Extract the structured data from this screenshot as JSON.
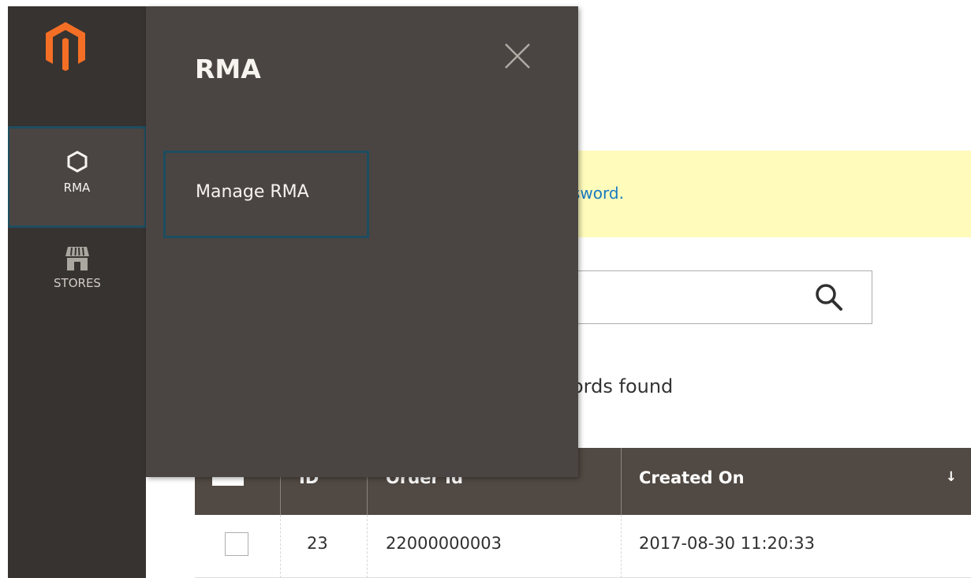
{
  "sidebar": {
    "logo": "magento-logo",
    "items": [
      {
        "label": "RMA",
        "icon": "hexagon-icon",
        "active": true
      },
      {
        "label": "STORES",
        "icon": "store-icon",
        "active": false
      }
    ]
  },
  "flyout": {
    "title": "RMA",
    "close_icon": "close-icon",
    "items": [
      {
        "label": "Manage RMA"
      }
    ]
  },
  "background": {
    "notice_fragment": "sword.",
    "records_fragment": "ords found",
    "search_icon": "search-icon",
    "grid": {
      "columns": [
        "ID",
        "Order Id",
        "Created On"
      ],
      "sort_indicator": "↓",
      "rows": [
        {
          "id": "23",
          "order_id": "22000000003",
          "created_on": "2017-08-30 11:20:33"
        }
      ]
    }
  },
  "colors": {
    "sidebar_bg": "#373330",
    "flyout_bg": "#4a4542",
    "focus_border": "#1d4d60",
    "notice_bg": "#fffbbb",
    "grid_header_bg": "#514943",
    "link": "#1979c3"
  }
}
